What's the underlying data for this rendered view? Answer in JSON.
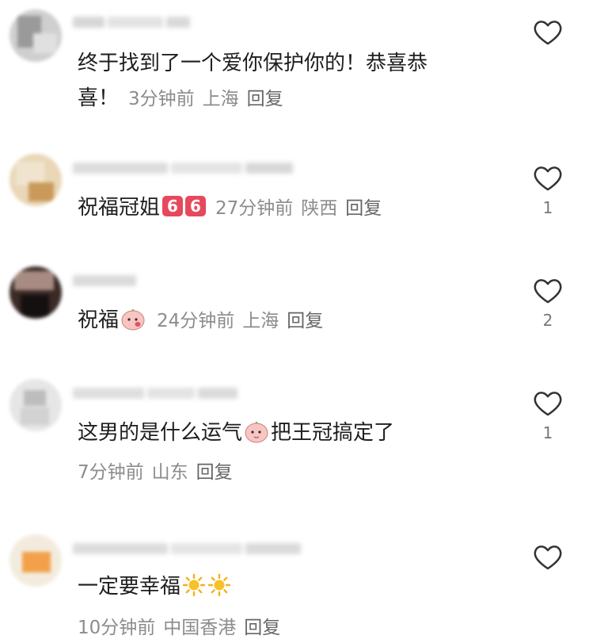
{
  "comments": [
    {
      "text_line1": "终于找到了一个爱你保护你的！恭喜恭",
      "text_line2": "喜！",
      "time": "3分钟前",
      "region": "上海",
      "reply": "回复",
      "likes": ""
    },
    {
      "text": "祝福冠姐",
      "badge": "6",
      "time": "27分钟前",
      "region": "陕西",
      "reply": "回复",
      "likes": "1"
    },
    {
      "text": "祝福",
      "time": "24分钟前",
      "region": "上海",
      "reply": "回复",
      "likes": "2"
    },
    {
      "text_before": "这男的是什么运气",
      "text_after": "把王冠搞定了",
      "time": "7分钟前",
      "region": "山东",
      "reply": "回复",
      "likes": "1"
    },
    {
      "text": "一定要幸福",
      "time": "10分钟前",
      "region": "中国香港",
      "reply": "回复",
      "likes": ""
    }
  ],
  "icons": {
    "like": "heart-outline-icon",
    "emoji_face": "pink-face-emoji-icon",
    "sun": "sun-emoji-icon",
    "number_badge": "keycap-six-icon"
  },
  "colors": {
    "meta": "#8c8c8c",
    "badge": "#e8485b"
  }
}
